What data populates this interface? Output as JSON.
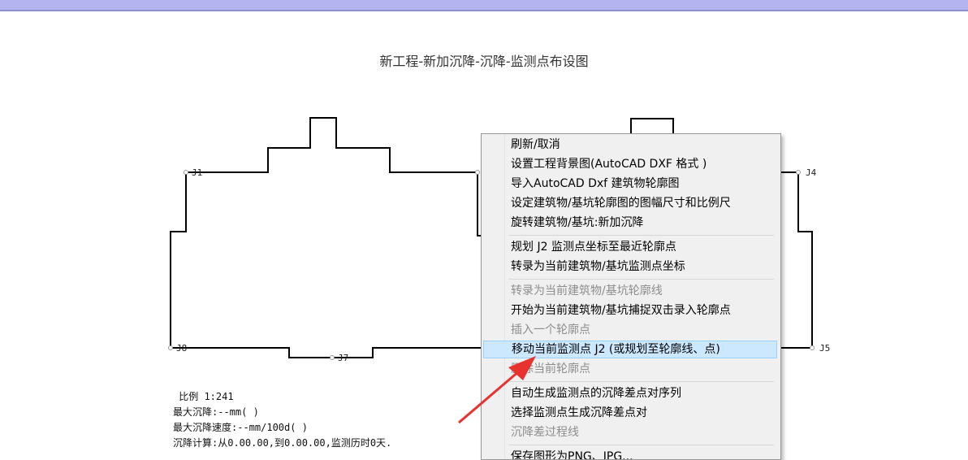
{
  "window": {
    "title_bar_color": "#b4b4f0"
  },
  "drawing": {
    "title": "新工程-新加沉降-沉降-监测点布设图",
    "points": [
      {
        "id": "J1",
        "label": "J1"
      },
      {
        "id": "J4",
        "label": "J4"
      },
      {
        "id": "J5",
        "label": "J5"
      },
      {
        "id": "J7",
        "label": "J7"
      },
      {
        "id": "J8",
        "label": "J8"
      }
    ],
    "info": {
      "scale": " 比例 1:241",
      "max_settlement": "最大沉降:--mm( )",
      "max_rate": "最大沉降速度:--mm/100d( )",
      "calc": "沉降计算:从0.00.00,到0.00.00,监测历时0天."
    }
  },
  "context_menu": {
    "items": [
      {
        "label": "刷新/取消",
        "disabled": false
      },
      {
        "label": "设置工程背景图(AutoCAD DXF 格式 )",
        "disabled": false
      },
      {
        "label": "导入AutoCAD Dxf 建筑物轮廓图",
        "disabled": false
      },
      {
        "label": "设定建筑物/基坑轮廓图的图幅尺寸和比例尺",
        "disabled": false
      },
      {
        "label": "旋转建筑物/基坑:新加沉降",
        "disabled": false
      },
      {
        "label": "规划 J2 监测点坐标至最近轮廓点",
        "disabled": false
      },
      {
        "label": "转录为当前建筑物/基坑监测点坐标",
        "disabled": false
      },
      {
        "label": "转录为当前建筑物/基坑轮廓线",
        "disabled": true
      },
      {
        "label": "开始为当前建筑物/基坑捕捉双击录入轮廓点",
        "disabled": false
      },
      {
        "label": "插入一个轮廓点",
        "disabled": true
      },
      {
        "label": "移动当前监测点 J2 (或规划至轮廓线、点)",
        "disabled": false,
        "highlighted": true
      },
      {
        "label": "删除当前轮廓点",
        "disabled": true
      },
      {
        "label": "自动生成监测点的沉降差点对序列",
        "disabled": false
      },
      {
        "label": "选择监测点生成沉降差点对",
        "disabled": false
      },
      {
        "label": "沉降差过程线",
        "disabled": true
      },
      {
        "label": "保存图形为PNG、JPG...",
        "disabled": false
      }
    ]
  },
  "annotation": {
    "arrow_color": "#e8322e"
  }
}
